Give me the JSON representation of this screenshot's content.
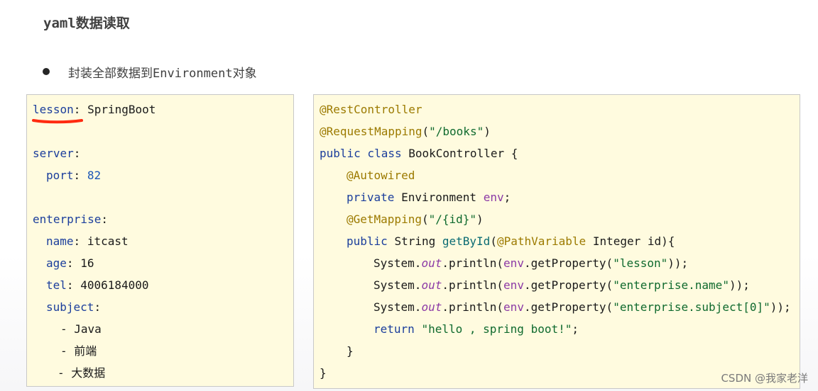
{
  "title": "yaml数据读取",
  "bullet": "封装全部数据到Environment对象",
  "yaml": {
    "lesson_key": "lesson",
    "lesson_value": "SpringBoot",
    "server_key": "server",
    "port_key": "port",
    "port_value": "82",
    "enterprise_key": "enterprise",
    "name_key": "name",
    "name_value": "itcast",
    "age_key": "age",
    "age_value": "16",
    "tel_key": "tel",
    "tel_value": "4006184000",
    "subject_key": "subject",
    "subjects": [
      "- Java",
      "- 前端",
      "- 大数据"
    ],
    "colon": ":"
  },
  "java": {
    "ann_rest": "@RestController",
    "ann_req": "@RequestMapping",
    "req_path": "\"/books\"",
    "kw_public_class": "public class",
    "class_name": "BookController",
    "ann_autowired": "@Autowired",
    "kw_private": "private",
    "type_env": "Environment",
    "field_env": "env",
    "ann_get": "@GetMapping",
    "get_path": "\"/{id}\"",
    "kw_public": "public",
    "type_string": "String",
    "method_name": "getById",
    "ann_pathvar": "@PathVariable",
    "param": "Integer id",
    "sys": "System.",
    "out": "out",
    "println": ".println(",
    "get_property": ".getProperty(",
    "str_lesson": "\"lesson\"",
    "str_name": "\"enterprise.name\"",
    "str_subject": "\"enterprise.subject[0]\"",
    "kw_return": "return",
    "str_hello": "\"hello , spring boot!\""
  },
  "watermark": "CSDN @我家老洋"
}
